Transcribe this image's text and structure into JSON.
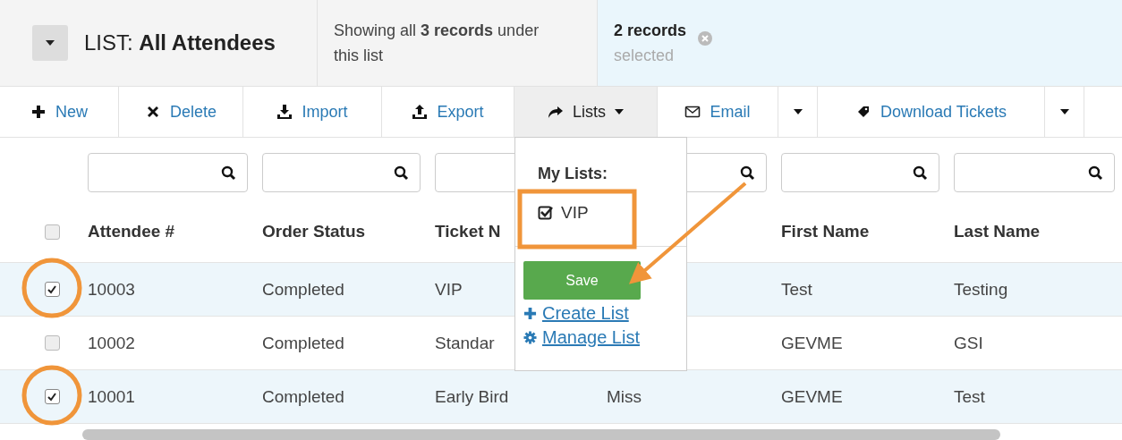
{
  "list_header": {
    "prefix": "LIST:",
    "name": "All Attendees"
  },
  "summary": "Showing all **3 records** under this list",
  "selection": {
    "count": "2 records",
    "note": "selected"
  },
  "toolbar": [
    {
      "label": "New",
      "kind": "action",
      "selected": false
    },
    {
      "label": "Delete",
      "kind": "action",
      "selected": false
    },
    {
      "label": "Import",
      "kind": "action",
      "selected": false
    },
    {
      "label": "Export",
      "kind": "action",
      "selected": false
    },
    {
      "label": "Lists",
      "kind": "menu",
      "selected": true
    },
    {
      "label": "Email",
      "kind": "split",
      "selected": false
    },
    {
      "label": "Download Tickets",
      "kind": "split",
      "selected": false
    }
  ],
  "lists_menu": {
    "heading": "My Lists:",
    "lists": [
      {
        "label": "VIP",
        "checked": true
      }
    ],
    "save": "Save",
    "links": [
      "Create List",
      "Manage List"
    ]
  },
  "table": {
    "all_checked": false,
    "columns": [
      "Attendee #",
      "Order Status",
      "Ticket N",
      null,
      "First Name",
      "Last Name"
    ],
    "rows": [
      {
        "selected": true,
        "cells": [
          "10003",
          "Completed",
          "VIP",
          null,
          "Test",
          "Testing"
        ]
      },
      {
        "selected": false,
        "cells": [
          "10002",
          "Completed",
          "Standar",
          null,
          "GEVME",
          "GSI"
        ]
      },
      {
        "selected": true,
        "cells": [
          "10001",
          "Completed",
          "Early Bird",
          "Miss",
          "GEVME",
          "Test"
        ]
      }
    ]
  }
}
